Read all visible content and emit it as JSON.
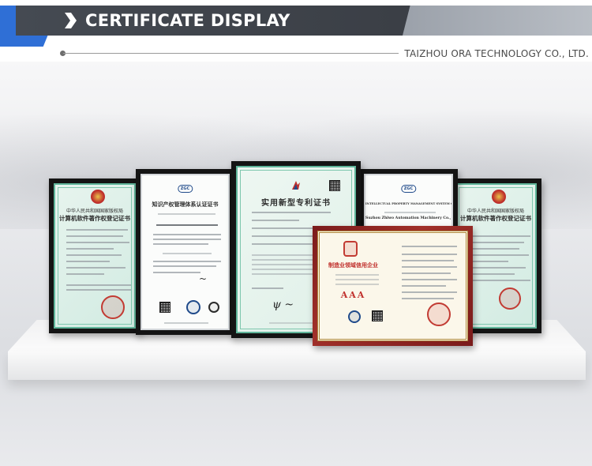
{
  "header": {
    "title": "CERTIFICATE DISPLAY",
    "company": "TAIZHOU ORA TECHNOLOGY CO., LTD.",
    "accent_blue": "#2f6fd6",
    "banner_dark": "#454a52",
    "banner_grey": "#b0b5bc"
  },
  "certificates": {
    "left_software": {
      "title1": "中华人民共和国国家版权局",
      "title2": "计算机软件著作权登记证书"
    },
    "ip_management": {
      "logo": "ZGC",
      "title": "知识产权管理体系认证证书"
    },
    "utility_patent": {
      "title": "实用新型专利证书"
    },
    "ip_english": {
      "logo": "ZGC",
      "title": "INTELLECTUAL PROPERTY MANAGEMENT SYSTEM CERTIFICATE",
      "company": "Suzhou Zhiwo Automation Machinery Co., Ltd."
    },
    "right_software": {
      "title1": "中华人民共和国国家版权局",
      "title2": "计算机软件著作权登记证书"
    },
    "credit": {
      "title": "制造业领域信用企业",
      "rating": "AAA"
    }
  }
}
